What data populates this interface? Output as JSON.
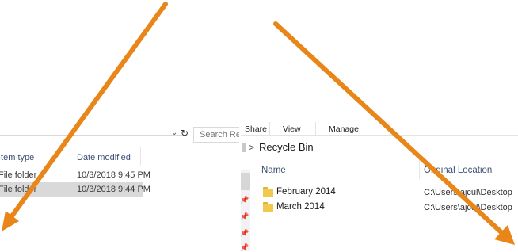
{
  "left": {
    "search_placeholder": "Search Recy",
    "columns": [
      "Item type",
      "Date modified"
    ],
    "rows": [
      {
        "type": "File folder",
        "date": "10/3/2018 9:45 PM",
        "selected": false
      },
      {
        "type": "File folder",
        "date": "10/3/2018 9:44 PM",
        "selected": true
      }
    ],
    "icons": {
      "dropdown": "chevron-down-icon",
      "refresh": "refresh-icon"
    }
  },
  "right": {
    "tabs": [
      "Share",
      "View",
      "Manage"
    ],
    "breadcrumb_sep": ">",
    "location": "Recycle Bin",
    "columns": [
      "Name",
      "Original Location"
    ],
    "rows": [
      {
        "name": "February 2014",
        "location": "C:\\Users\\ajcul\\Desktop"
      },
      {
        "name": "March 2014",
        "location": "C:\\Users\\ajcul\\Desktop"
      }
    ],
    "icons": {
      "folder": "folder-icon",
      "pin": "pin-icon"
    }
  },
  "overlay": {
    "arrow_color": "#e8861a",
    "arrows": [
      "arrow-down-left",
      "arrow-down-right"
    ]
  }
}
